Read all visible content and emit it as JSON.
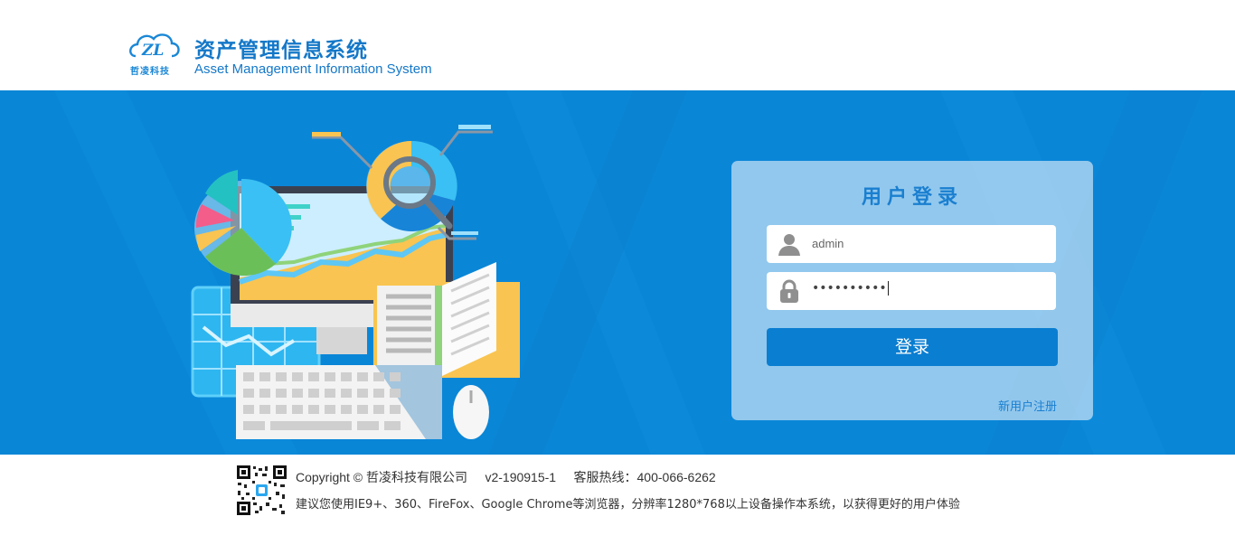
{
  "header": {
    "logo_text": "哲凌科技",
    "title_cn": "资产管理信息系统",
    "title_en": "Asset Management Information System"
  },
  "login": {
    "title": "用户登录",
    "username_value": "admin",
    "password_dots": "••••••••••",
    "submit_label": "登录",
    "register_label": "新用户注册"
  },
  "footer": {
    "line1": "Copyright © 哲凌科技有限公司     v2-190915-1     客服热线：400-066-6262",
    "line2": "建议您使用IE9+、360、FireFox、Google Chrome等浏览器，分辨率1280*768以上设备操作本系统，以获得更好的用户体验"
  },
  "colors": {
    "brand": "#1478c8",
    "banner": "#0a86d7",
    "button": "#0a7ed1"
  }
}
